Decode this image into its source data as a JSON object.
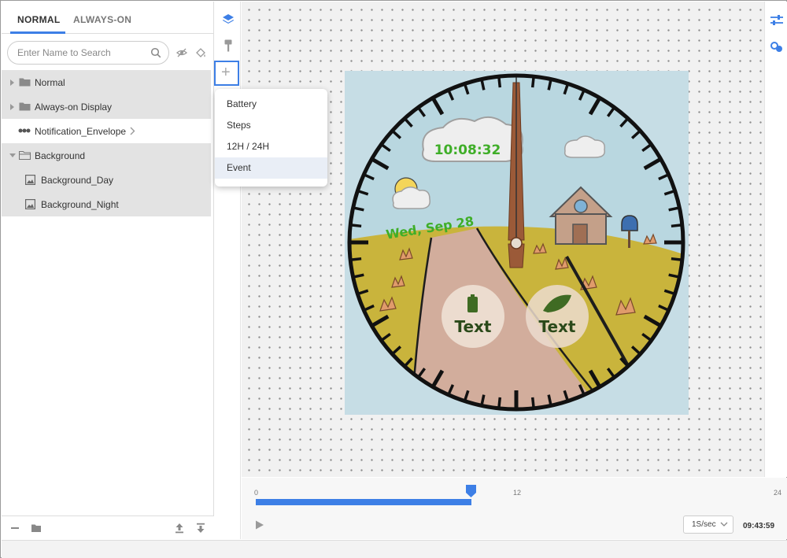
{
  "tabs": [
    {
      "label": "NORMAL",
      "active": true
    },
    {
      "label": "ALWAYS-ON",
      "active": false
    }
  ],
  "search": {
    "placeholder": "Enter Name to Search",
    "value": ""
  },
  "tree": {
    "items": [
      {
        "label": "Normal",
        "type": "folder",
        "expanded": false
      },
      {
        "label": "Always-on Display",
        "type": "folder",
        "expanded": false
      },
      {
        "label": "Notification_Envelope",
        "type": "component",
        "selected": true
      },
      {
        "label": "Background",
        "type": "folder",
        "expanded": true
      },
      {
        "label": "Background_Day",
        "type": "image"
      },
      {
        "label": "Background_Night",
        "type": "image"
      }
    ]
  },
  "add_menu": {
    "items": [
      "Battery",
      "Steps",
      "12H / 24H",
      "Event"
    ],
    "hovered": "Event"
  },
  "watch_face": {
    "time_text": "10:08:32",
    "date_text": "Wed, Sep 28",
    "complication_left": "Text",
    "complication_right": "Text"
  },
  "timeline": {
    "ticks": [
      "0",
      "12",
      "24"
    ],
    "progress_fraction": 0.41,
    "speed": "1S/sec",
    "current_time": "09:43:59"
  },
  "colors": {
    "accent": "#3d7fe6",
    "digital_text": "#3fae28",
    "grass": "#c9b43c",
    "sky": "#b7d4de",
    "path": "#d2ad9c"
  },
  "icons": {
    "toolbar": [
      "layers-icon",
      "brush-icon",
      "add-icon"
    ],
    "right": [
      "sliders-icon",
      "link-icon"
    ],
    "footer": [
      "remove-icon",
      "folder-icon",
      "move-top-icon",
      "move-bottom-icon"
    ]
  }
}
